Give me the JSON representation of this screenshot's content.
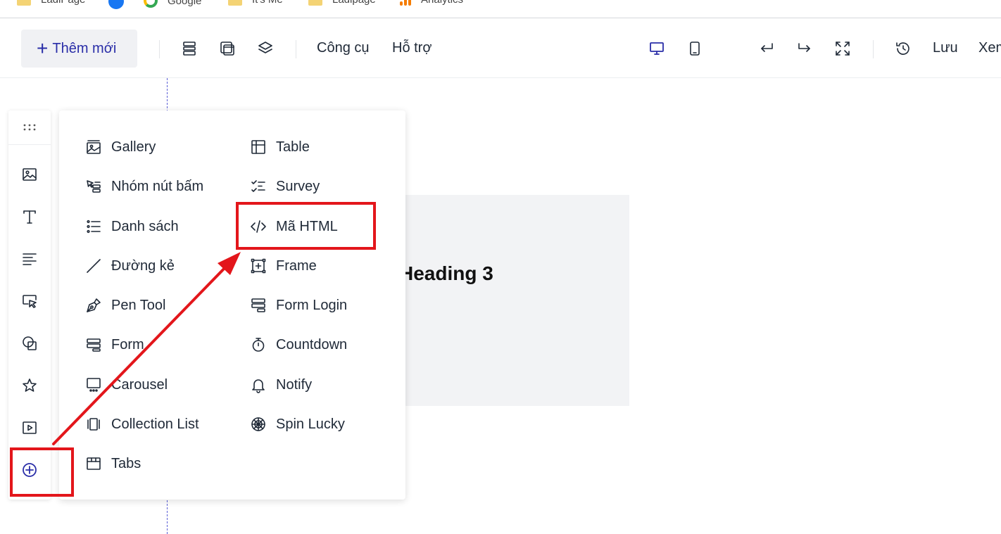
{
  "bookmarks": [
    {
      "label": "LadiPage",
      "icon": "folder-icon"
    },
    {
      "label": "",
      "icon": "facebook-icon"
    },
    {
      "label": "Google",
      "icon": "google-icon"
    },
    {
      "label": "It's Me",
      "icon": "folder-icon"
    },
    {
      "label": "Ladipage",
      "icon": "folder-icon"
    },
    {
      "label": "Analytics",
      "icon": "analytics-icon"
    }
  ],
  "toolbar": {
    "add_label": "Thêm mới",
    "tools_label": "Công cụ",
    "support_label": "Hỗ trợ",
    "save_label": "Lưu",
    "preview_label": "Xem"
  },
  "canvas": {
    "heading": "Heading 3"
  },
  "popup": {
    "left_column": [
      {
        "label": "Gallery",
        "icon": "gallery-icon"
      },
      {
        "label": "Nhóm nút bấm",
        "icon": "button-group-icon"
      },
      {
        "label": "Danh sách",
        "icon": "list-icon"
      },
      {
        "label": "Đường kẻ",
        "icon": "line-icon"
      },
      {
        "label": "Pen Tool",
        "icon": "pen-tool-icon"
      },
      {
        "label": "Form",
        "icon": "form-icon"
      },
      {
        "label": "Carousel",
        "icon": "carousel-icon"
      },
      {
        "label": "Collection List",
        "icon": "collection-list-icon"
      },
      {
        "label": "Tabs",
        "icon": "tabs-icon"
      }
    ],
    "right_column": [
      {
        "label": "Table",
        "icon": "table-icon"
      },
      {
        "label": "Survey",
        "icon": "survey-icon"
      },
      {
        "label": "Mã HTML",
        "icon": "code-icon"
      },
      {
        "label": "Frame",
        "icon": "frame-icon"
      },
      {
        "label": "Form Login",
        "icon": "form-login-icon"
      },
      {
        "label": "Countdown",
        "icon": "countdown-icon"
      },
      {
        "label": "Notify",
        "icon": "bell-icon"
      },
      {
        "label": "Spin Lucky",
        "icon": "spin-wheel-icon"
      }
    ]
  },
  "colors": {
    "accent": "#2a2ea8",
    "highlight": "#e3161b",
    "section_bg": "#f2f3f5"
  }
}
